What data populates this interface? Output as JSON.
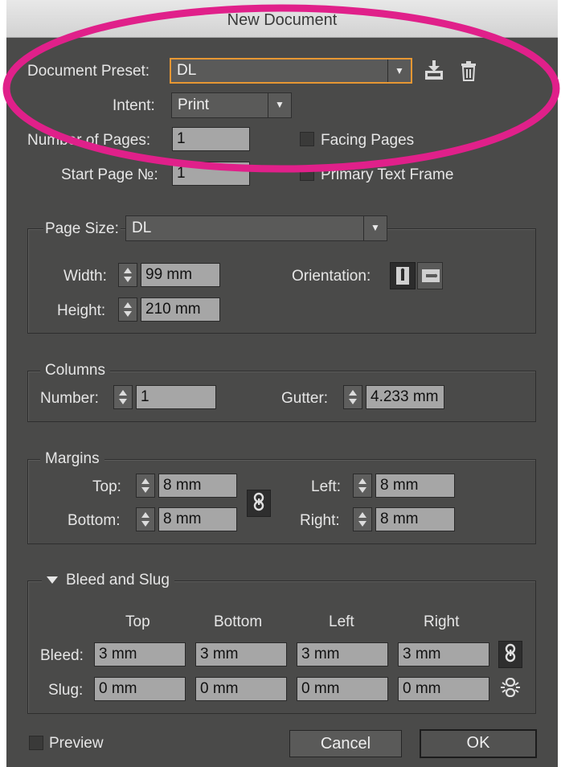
{
  "window": {
    "title": "New Document"
  },
  "document": {
    "preset_label": "Document Preset:",
    "preset_value": "DL",
    "intent_label": "Intent:",
    "intent_value": "Print",
    "pages_label": "Number of Pages:",
    "pages_value": "1",
    "start_label": "Start Page №:",
    "start_value": "1",
    "facing_label": "Facing Pages",
    "facing_checked": false,
    "primary_label": "Primary Text Frame",
    "primary_checked": false
  },
  "page_size": {
    "label": "Page Size:",
    "value": "DL",
    "width_label": "Width:",
    "width_value": "99 mm",
    "height_label": "Height:",
    "height_value": "210 mm",
    "orientation_label": "Orientation:",
    "orientation_selected": "portrait"
  },
  "columns": {
    "title": "Columns",
    "number_label": "Number:",
    "number_value": "1",
    "gutter_label": "Gutter:",
    "gutter_value": "4.233 mm"
  },
  "margins": {
    "title": "Margins",
    "top_label": "Top:",
    "top_value": "8 mm",
    "bottom_label": "Bottom:",
    "bottom_value": "8 mm",
    "left_label": "Left:",
    "left_value": "8 mm",
    "right_label": "Right:",
    "right_value": "8 mm",
    "linked": true
  },
  "bleed_slug": {
    "title": "Bleed and Slug",
    "headers": [
      "Top",
      "Bottom",
      "Left",
      "Right"
    ],
    "bleed_label": "Bleed:",
    "bleed_values": [
      "3 mm",
      "3 mm",
      "3 mm",
      "3 mm"
    ],
    "slug_label": "Slug:",
    "slug_values": [
      "0 mm",
      "0 mm",
      "0 mm",
      "0 mm"
    ],
    "bleed_linked": true,
    "slug_linked": false
  },
  "footer": {
    "preview_label": "Preview",
    "preview_checked": false,
    "cancel_label": "Cancel",
    "ok_label": "OK"
  },
  "colors": {
    "dialog_bg": "#4a4a49",
    "focus_ring": "#e79733",
    "annotation": "#e0208a"
  },
  "icons": [
    "save-preset-icon",
    "delete-preset-icon",
    "portrait-icon",
    "landscape-icon",
    "chain-link-icon",
    "chain-broken-icon",
    "disclosure-triangle-icon",
    "dropdown-arrow-icon"
  ]
}
